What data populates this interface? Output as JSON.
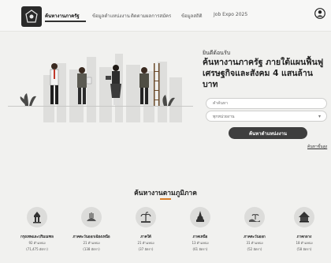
{
  "header": {
    "nav": [
      {
        "label": "ค้นหางานภาครัฐ",
        "active": true
      },
      {
        "label": "ข้อมูลตำแหน่งงาน",
        "active": false
      },
      {
        "label": "ติดตามผลการสมัคร",
        "active": false
      },
      {
        "label": "ข้อมูลสถิติ",
        "active": false
      },
      {
        "label": "Job Expo 2025",
        "active": false
      }
    ]
  },
  "hero": {
    "welcome": "ยินดีต้อนรับ",
    "title": "ค้นหางานภาครัฐ ภายใต้แผนฟื้นฟูเศรษฐกิจและสังคม 4 แสนล้านบาท",
    "keyword_placeholder": "คำค้นหา",
    "location_placeholder": "สถานที่ทำงาน",
    "dropdown_value": "ทุกหน่วยงาน",
    "search_label": "ค้นหาตำแหน่งงาน",
    "advanced_link": "ค้นหาขั้นสูง"
  },
  "categories": {
    "title": "ค้นหางานตามภูมิภาค",
    "items": [
      {
        "name": "กรุงเทพและปริมณฑล",
        "count": "92 ตำแหน่ง",
        "new": "(71,475 อัตรา)",
        "icon": "temple-icon"
      },
      {
        "name": "ภาคตะวันออกเฉียงเหนือ",
        "count": "21 ตำแหน่ง",
        "new": "(138 อัตรา)",
        "icon": "field-icon"
      },
      {
        "name": "ภาคใต้",
        "count": "21 ตำแหน่ง",
        "new": "(37 อัตรา)",
        "icon": "beach-icon"
      },
      {
        "name": "ภาคเหนือ",
        "count": "13 ตำแหน่ง",
        "new": "(61 อัตรา)",
        "icon": "pagoda-icon"
      },
      {
        "name": "ภาคตะวันออก",
        "count": "31 ตำแหน่ง",
        "new": "(52 อัตรา)",
        "icon": "island-icon"
      },
      {
        "name": "ภาคกลาง",
        "count": "18 ตำแหน่ง",
        "new": "(58 อัตรา)",
        "icon": "shrine-icon"
      }
    ]
  },
  "colors": {
    "accent": "#d97e2a",
    "button": "#3e3e3e",
    "background": "#f1f1ef"
  }
}
